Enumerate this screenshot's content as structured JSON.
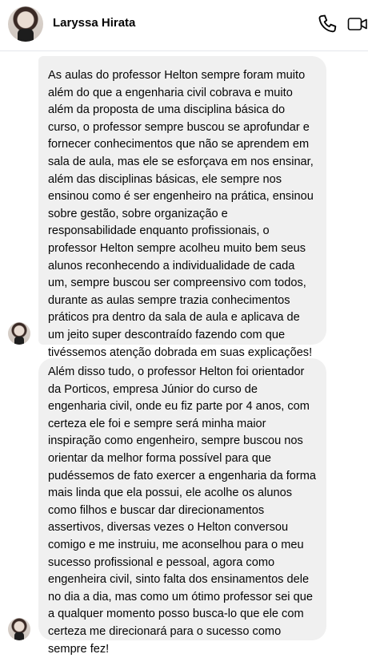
{
  "header": {
    "contact_name": "Laryssa Hirata",
    "call_icon": "phone-icon",
    "video_icon": "video-camera-icon"
  },
  "messages": [
    {
      "text": "As aulas do professor Helton sempre foram muito além do que a engenharia civil cobrava e muito além da proposta de uma disciplina básica do curso, o professor sempre buscou se aprofundar e fornecer conhecimentos que não se aprendem em sala de aula, mas ele se esforçava em nos ensinar, além das disciplinas básicas, ele sempre nos ensinou como é ser engenheiro na prática, ensinou sobre gestão, sobre organização e responsabilidade enquanto profissionais, o professor Helton sempre acolheu muito bem seus alunos reconhecendo a individualidade de cada um, sempre buscou ser compreensivo com todos, durante as aulas sempre trazia conhecimentos práticos pra dentro da sala de aula e aplicava de um jeito super descontraído fazendo com que tivéssemos atenção dobrada em suas explicações!"
    },
    {
      "text": "Além disso tudo, o professor Helton foi orientador da Porticos, empresa Júnior do curso de engenharia civil, onde eu fiz parte por 4 anos, com certeza ele foi e sempre será minha maior inspiração como engenheiro, sempre buscou nos orientar da melhor forma possível para que pudéssemos de fato exercer a engenharia da forma mais linda que ela possui, ele acolhe os alunos como filhos e buscar dar direcionamentos assertivos, diversas vezes o Helton conversou comigo e me instruiu, me aconselhou para o meu sucesso profissional e pessoal, agora como engenheira civil, sinto falta dos ensinamentos dele no dia a dia, mas como um ótimo professor sei que a qualquer momento posso busca-lo que ele com certeza me direcionará para o sucesso como sempre fez!"
    }
  ],
  "colors": {
    "bubble": "#f0f0f0",
    "text": "#050505",
    "divider": "#e4e6eb"
  }
}
